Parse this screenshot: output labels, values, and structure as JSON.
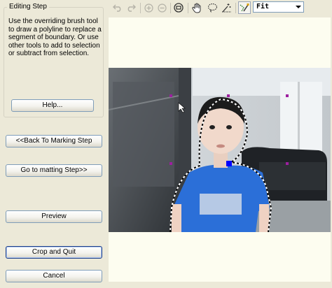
{
  "panel": {
    "group_title": "Editing Step",
    "instructions": "Use the overriding brush tool to draw a polyline to replace a segment of boundary. Or use other tools to add to selection or subtract from selection.",
    "help_label": "Help...",
    "back_label": "<<Back To Marking Step",
    "matting_label": "Go to matting Step>>",
    "preview_label": "Preview",
    "crop_label": "Crop and Quit",
    "cancel_label": "Cancel"
  },
  "toolbar": {
    "icons": [
      "undo-icon",
      "redo-icon",
      "zoom-in-icon",
      "zoom-out-icon",
      "fit-window-icon",
      "hand-icon",
      "lasso-icon",
      "magic-brush-icon",
      "override-brush-icon"
    ],
    "zoom_value": "Fit"
  },
  "canvas": {
    "background": "#fdfdf0",
    "photo_subject": "child-in-blue-tshirt"
  },
  "colors": {
    "window_bg": "#ece9d8",
    "button_border": "#7f9db9",
    "default_button_border": "#1c3e88",
    "marker": "#9d1f9f",
    "selected_marker": "#0000ff"
  }
}
